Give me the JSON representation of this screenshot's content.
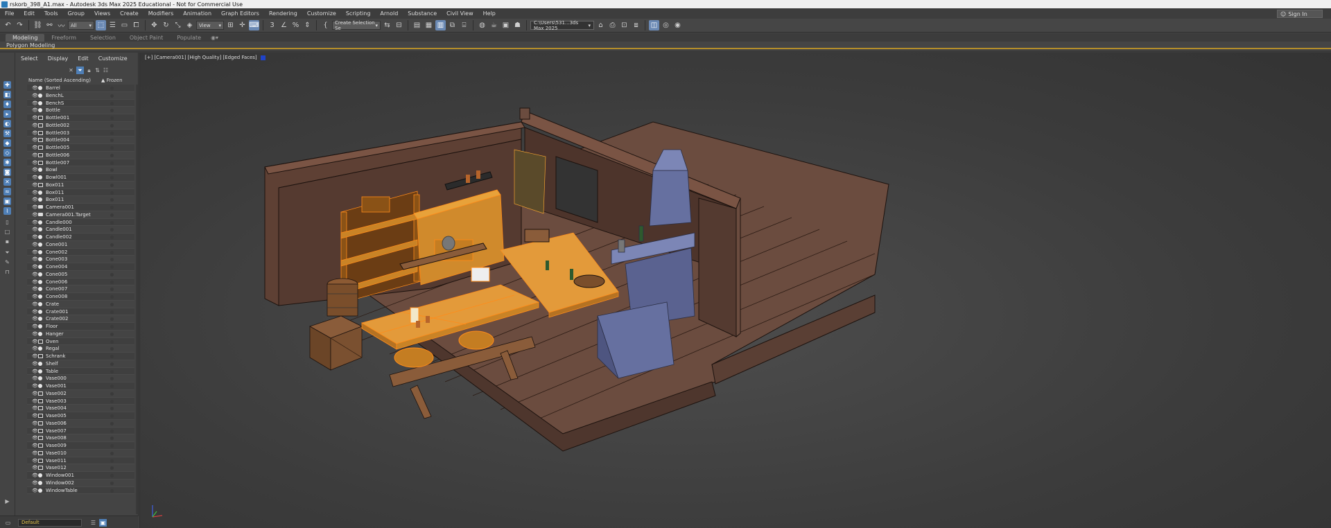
{
  "window": {
    "title": "rskorb_398_A1.max - Autodesk 3ds Max 2025 Educational - Not for Commercial Use"
  },
  "menu": [
    "File",
    "Edit",
    "Tools",
    "Group",
    "Views",
    "Create",
    "Modifiers",
    "Animation",
    "Graph Editors",
    "Rendering",
    "Customize",
    "Scripting",
    "Arnold",
    "Substance",
    "Civil View",
    "Help"
  ],
  "account": {
    "sign_in": "Sign In"
  },
  "toolbar": {
    "selection_filter": "All",
    "ref_coord": "View",
    "named_selection_placeholder": "Create Selection Se",
    "project_path": "C:\\Users\\531...3ds Max 2025"
  },
  "ribbon": {
    "tabs": [
      "Modeling",
      "Freeform",
      "Selection",
      "Object Paint",
      "Populate"
    ],
    "active_tab": "Modeling",
    "panel_label": "Polygon Modeling"
  },
  "explorer": {
    "menu": [
      "Select",
      "Display",
      "Edit",
      "Customize"
    ],
    "col_name": "Name (Sorted Ascending)",
    "col_frozen": "▲ Frozen",
    "objects": [
      {
        "name": "Barrel",
        "type": "geo"
      },
      {
        "name": "BenchL",
        "type": "geo"
      },
      {
        "name": "BenchS",
        "type": "geo"
      },
      {
        "name": "Bottle",
        "type": "geo"
      },
      {
        "name": "Bottle001",
        "type": "group"
      },
      {
        "name": "Bottle002",
        "type": "group"
      },
      {
        "name": "Bottle003",
        "type": "group"
      },
      {
        "name": "Bottle004",
        "type": "group"
      },
      {
        "name": "Bottle005",
        "type": "group"
      },
      {
        "name": "Bottle006",
        "type": "group"
      },
      {
        "name": "Bottle007",
        "type": "group"
      },
      {
        "name": "Bowl",
        "type": "geo"
      },
      {
        "name": "Bowl001",
        "type": "geo"
      },
      {
        "name": "Box011",
        "type": "group"
      },
      {
        "name": "Box011",
        "type": "geo"
      },
      {
        "name": "Box011",
        "type": "geo"
      },
      {
        "name": "Camera001",
        "type": "cam"
      },
      {
        "name": "Camera001.Target",
        "type": "cam"
      },
      {
        "name": "Candle000",
        "type": "geo"
      },
      {
        "name": "Candle001",
        "type": "geo"
      },
      {
        "name": "Candle002",
        "type": "geo"
      },
      {
        "name": "Cone001",
        "type": "geo"
      },
      {
        "name": "Cone002",
        "type": "geo"
      },
      {
        "name": "Cone003",
        "type": "geo"
      },
      {
        "name": "Cone004",
        "type": "geo"
      },
      {
        "name": "Cone005",
        "type": "geo"
      },
      {
        "name": "Cone006",
        "type": "geo"
      },
      {
        "name": "Cone007",
        "type": "geo"
      },
      {
        "name": "Cone008",
        "type": "geo"
      },
      {
        "name": "Crate",
        "type": "geo"
      },
      {
        "name": "Crate001",
        "type": "geo"
      },
      {
        "name": "Crate002",
        "type": "geo"
      },
      {
        "name": "Floor",
        "type": "geo"
      },
      {
        "name": "Hanger",
        "type": "geo"
      },
      {
        "name": "Oven",
        "type": "group"
      },
      {
        "name": "Regal",
        "type": "geo"
      },
      {
        "name": "Schrank",
        "type": "group"
      },
      {
        "name": "Shelf",
        "type": "geo"
      },
      {
        "name": "Table",
        "type": "geo"
      },
      {
        "name": "Vase000",
        "type": "geo"
      },
      {
        "name": "Vase001",
        "type": "geo"
      },
      {
        "name": "Vase002",
        "type": "group"
      },
      {
        "name": "Vase003",
        "type": "group"
      },
      {
        "name": "Vase004",
        "type": "group"
      },
      {
        "name": "Vase005",
        "type": "group"
      },
      {
        "name": "Vase006",
        "type": "group"
      },
      {
        "name": "Vase007",
        "type": "group"
      },
      {
        "name": "Vase008",
        "type": "group"
      },
      {
        "name": "Vase009",
        "type": "group"
      },
      {
        "name": "Vase010",
        "type": "group"
      },
      {
        "name": "Vase011",
        "type": "group"
      },
      {
        "name": "Vase012",
        "type": "group"
      },
      {
        "name": "Window001",
        "type": "geo"
      },
      {
        "name": "Window002",
        "type": "geo"
      },
      {
        "name": "WindowTable",
        "type": "geo"
      }
    ]
  },
  "viewport": {
    "label_plus": "[+]",
    "label_camera": "[Camera001]",
    "label_quality": "[High Quality]",
    "label_shading": "[Edged Faces]"
  },
  "status": {
    "layer": "Default"
  },
  "colors": {
    "accent": "#6a89b4",
    "ribbon_underline": "#b58e2a",
    "layer_text": "#e6c54b",
    "selected_wireframe": "#ff8c1a",
    "oven_blue": "#6670a0"
  }
}
